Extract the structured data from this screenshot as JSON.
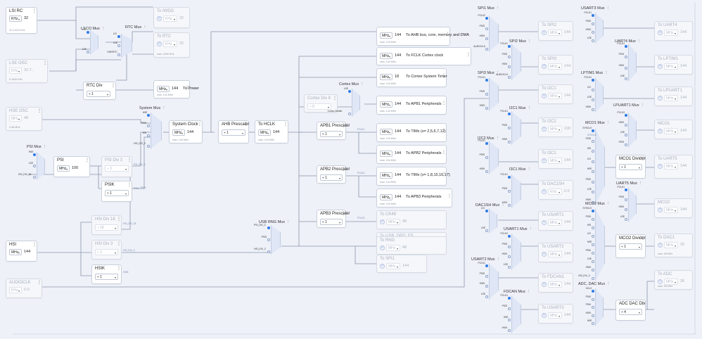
{
  "sources": [
    {
      "name": "LSI RC",
      "unit": "KHz",
      "value": "32",
      "sub": "31.4-32.6 kHz",
      "disabled": false
    },
    {
      "name": "LSE OSC",
      "unit": "KHz",
      "value": "32.7..",
      "sub": "0-1000 KHz",
      "disabled": true
    },
    {
      "name": "HSE OSC",
      "unit": "MHz",
      "value": "48",
      "sub": "4-48 MHz",
      "disabled": true
    },
    {
      "name": "HSI",
      "unit": "MHz",
      "value": "144",
      "disabled": false
    },
    {
      "name": "AUDIOCLK",
      "unit": "KHz",
      "value": "0.0",
      "disabled": true
    }
  ],
  "muxes": [
    {
      "name": "LSCO Mux",
      "inputs": [
        "LSI",
        "LSE"
      ]
    },
    {
      "name": "RTC Mux",
      "inputs": [
        "LSI",
        "LSE",
        "HSE/RTC"
      ]
    },
    {
      "name": "System Mux",
      "inputs": [
        "HSE",
        "PSIS",
        "HSI",
        "HSI_DIV_3"
      ]
    },
    {
      "name": "PSI Mux",
      "inputs": [
        "HSE",
        "LSE",
        "HSI_DIV_18"
      ]
    },
    {
      "name": "Cortex Mux",
      "inputs": [
        "LSE",
        "Cortex Divider"
      ]
    },
    {
      "name": "USB RNG Mux",
      "inputs": [
        "PSI_DIV_3",
        "PSIS",
        "HSI_DIV_3"
      ]
    },
    {
      "name": "SPI1 Mux",
      "inputs": [
        "PCLK2",
        "PSIS",
        "HSIK",
        "AUDIOCLK"
      ]
    },
    {
      "name": "SPI2 Mux",
      "inputs": [
        "PCLK1",
        "PSIS",
        "HSIK",
        "AUDIOCLK"
      ]
    },
    {
      "name": "SPI3 Mux",
      "inputs": [
        "PCLK1",
        "PSIS",
        "HSIK"
      ]
    },
    {
      "name": "I2C1 Mux",
      "inputs": [
        "PCLK1",
        "PSIS",
        "HSIK"
      ]
    },
    {
      "name": "I2C2 Mux",
      "inputs": [
        "PCLK1",
        "PSIS",
        "HSIK"
      ]
    },
    {
      "name": "I3C1 Mux",
      "inputs": [
        "PCLK1",
        "PSIS",
        "HSIK"
      ]
    },
    {
      "name": "DAC1SH Mux",
      "inputs": [
        "LSI",
        "LSE"
      ]
    },
    {
      "name": "USART1 Mux",
      "inputs": [
        "PCLK2",
        "PSIS",
        "HSIK",
        "LSE"
      ]
    },
    {
      "name": "USART2 Mux",
      "inputs": [
        "PCLK1",
        "PSIS",
        "HSIK",
        "LSE"
      ]
    },
    {
      "name": "FDCAN Mux",
      "inputs": [
        "PCLK1",
        "PSIS",
        "HSE",
        "HSIK"
      ]
    },
    {
      "name": "USART3 Mux",
      "inputs": [
        "PCLK1",
        "PSIS",
        "HSIK",
        "LSE"
      ]
    },
    {
      "name": "UART4 Mux",
      "inputs": [
        "PCLK1",
        "PSIS",
        "HSIK",
        "LSE"
      ]
    },
    {
      "name": "LPTIM1 Mux",
      "inputs": [
        "PCLK1",
        "LSI",
        "LSE",
        "HSIK"
      ]
    },
    {
      "name": "LPUART1 Mux",
      "inputs": [
        "PCLK3",
        "HSIK",
        "LSE",
        "PSIS"
      ]
    },
    {
      "name": "MCO1 Mux",
      "inputs": [
        "SYSCLK",
        "PSIS",
        "HSI",
        "LSI",
        "HSE",
        "PSIK",
        "LSE",
        "HSIK"
      ]
    },
    {
      "name": "UART5 Mux",
      "inputs": [
        "PCLK1",
        "PSIS",
        "HSIK",
        "LSE"
      ]
    },
    {
      "name": "MCO2 Mux",
      "inputs": [
        "SYSCLK",
        "PSIS",
        "HSI",
        "LSI",
        "HSE",
        "PSIK",
        "LSE",
        "HSIK",
        "HSI_DIV_3"
      ]
    },
    {
      "name": "ADC, DAC Mux",
      "inputs": [
        "HCLK",
        "PSIS",
        "PSIK",
        "HSIK",
        "HSE"
      ]
    }
  ],
  "dividers": [
    {
      "name": "RTC Div",
      "value": "÷ 1"
    },
    {
      "name": "System Clock",
      "unit": "MHz",
      "value": "144",
      "sub": "max: 144 MHz"
    },
    {
      "name": "AHB Prescaler",
      "value": "÷ 1"
    },
    {
      "name": "To HCLK",
      "unit": "MHz",
      "value": "144",
      "sub": "max: 144 MHz"
    },
    {
      "name": "Cortex Div 8",
      "value": "÷ 8"
    },
    {
      "name": "APB1 Prescaler",
      "value": "÷ 1"
    },
    {
      "name": "APB2 Prescaler",
      "value": "÷ 1"
    },
    {
      "name": "APB3 Prescaler",
      "value": "÷ 1"
    },
    {
      "name": "PSI",
      "unit": "MHz",
      "value": "100"
    },
    {
      "name": "PSI Div 3",
      "value": "÷ 3"
    },
    {
      "name": "PSIK",
      "value": "÷ 1"
    },
    {
      "name": "HSI Div 18",
      "value": "÷ 18"
    },
    {
      "name": "HSI Div 3",
      "value": "÷ 3"
    },
    {
      "name": "HSIK",
      "value": "÷ 1"
    },
    {
      "name": "MCO1 Divider",
      "value": "÷ 1"
    },
    {
      "name": "MCO2 Divider",
      "value": "÷ 1"
    },
    {
      "name": "ADC DAC Div",
      "value": "÷ 4"
    }
  ],
  "outputs": [
    {
      "name": "To IWDG",
      "unit": "KHz",
      "value": "32"
    },
    {
      "name": "To RTC",
      "unit": "KHz",
      "value": "32",
      "sub": "max: 1000 KHz"
    },
    {
      "name": "To Power",
      "unit": "MHz",
      "value": "144",
      "sub": "max: 144 MHz"
    },
    {
      "name": "To AHB bus, core, memory and DMA",
      "unit": "MHz",
      "value": "144",
      "sub": "max: 144 MHz"
    },
    {
      "name": "To FCLK Cortex clock",
      "unit": "MHz",
      "value": "144",
      "sub": "max: 144 MHz"
    },
    {
      "name": "To Cortex System Timer",
      "unit": "MHz",
      "value": "18",
      "sub": "max: 144 MHz"
    },
    {
      "name": "To APB1 Peripherals",
      "unit": "MHz",
      "value": "144",
      "sub": "max: 144 MHz"
    },
    {
      "name": "To TIMx (x= 2,5,6,7,12)",
      "unit": "MHz",
      "value": "144",
      "sub": "max: 144 MHz"
    },
    {
      "name": "To APB2 Peripherals",
      "unit": "MHz",
      "value": "144",
      "sub": "max: 144 MHz"
    },
    {
      "name": "To TIMx (x= 1,8,15,16,17)",
      "unit": "MHz",
      "value": "144",
      "sub": "max: 144 MHz"
    },
    {
      "name": "To APB3 Peripherals",
      "unit": "MHz",
      "value": "144",
      "sub": "max: 144 MHz"
    },
    {
      "name": "To CK48",
      "unit": "MHz",
      "value": "48"
    },
    {
      "name": "To USB_DRD_FS",
      "unit": "MHz",
      "value": "48",
      "sub": "48.00 MHz"
    },
    {
      "name": "To RNG",
      "unit": "MHz",
      "value": "48"
    },
    {
      "name": "To SPI1",
      "unit": "MHz",
      "value": "144"
    },
    {
      "name": "To SPI2",
      "unit": "MHz",
      "value": "144"
    },
    {
      "name": "To SPI3",
      "unit": "MHz",
      "value": "144"
    },
    {
      "name": "To I2C1",
      "unit": "MHz",
      "value": "144"
    },
    {
      "name": "To I2C2",
      "unit": "MHz",
      "value": "100"
    },
    {
      "name": "To I3C1",
      "unit": "MHz",
      "value": "144"
    },
    {
      "name": "To DAC1SH",
      "unit": "KHz",
      "value": "0.0"
    },
    {
      "name": "To USART1",
      "unit": "MHz",
      "value": "144"
    },
    {
      "name": "To USART2",
      "unit": "MHz",
      "value": "144"
    },
    {
      "name": "To FDCAN1",
      "unit": "MHz",
      "value": "144"
    },
    {
      "name": "To USART3",
      "unit": "MHz",
      "value": "144"
    },
    {
      "name": "To UART4",
      "unit": "MHz",
      "value": "144"
    },
    {
      "name": "To LPTIM1",
      "unit": "MHz",
      "value": "144"
    },
    {
      "name": "To LPUART1",
      "unit": "MHz",
      "value": "144"
    },
    {
      "name": "MCO1",
      "unit": "MHz",
      "value": "144"
    },
    {
      "name": "To UART5",
      "unit": "MHz",
      "value": "144"
    },
    {
      "name": "MCO2",
      "unit": "MHz",
      "value": "144"
    },
    {
      "name": "To DAC1",
      "unit": "MHz",
      "value": "25",
      "sub": "max: 48 MHz"
    },
    {
      "name": "To ADC",
      "unit": "MHz",
      "value": "36",
      "sub": "max: 36 MHz"
    }
  ],
  "wire_labels": [
    "PCLK1",
    "PCLK2",
    "PCLK3",
    "PSI_DIV_3",
    "PSIS",
    "HSI_DIV_18",
    "HSI_DIV_3",
    "HSIK",
    "PSIK",
    "SYSCLK"
  ]
}
